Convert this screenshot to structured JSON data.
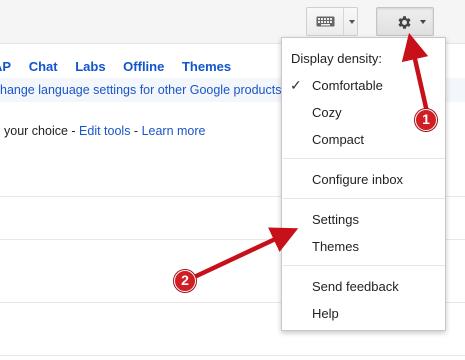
{
  "toolbar": {
    "keyboard_icon": "keyboard-icon",
    "gear_icon": "gear-icon"
  },
  "tabs": [
    "AP",
    "Chat",
    "Labs",
    "Offline",
    "Themes"
  ],
  "language_notice": "hange language settings for other Google products",
  "tools_line": {
    "prefix": "your choice - ",
    "edit_tools": "Edit tools",
    "separator": " - ",
    "learn_more": "Learn more"
  },
  "menu": {
    "header": "Display density:",
    "check_icon": "check-icon",
    "density": [
      "Comfortable",
      "Cozy",
      "Compact"
    ],
    "configure": "Configure inbox",
    "settings": "Settings",
    "themes": "Themes",
    "send_feedback": "Send feedback",
    "help": "Help"
  },
  "annotations": {
    "badge_1": "1",
    "badge_2": "2",
    "arrow_color": "#c8101a"
  },
  "colors": {
    "link": "#1155cc",
    "badge": "#d11d24"
  }
}
